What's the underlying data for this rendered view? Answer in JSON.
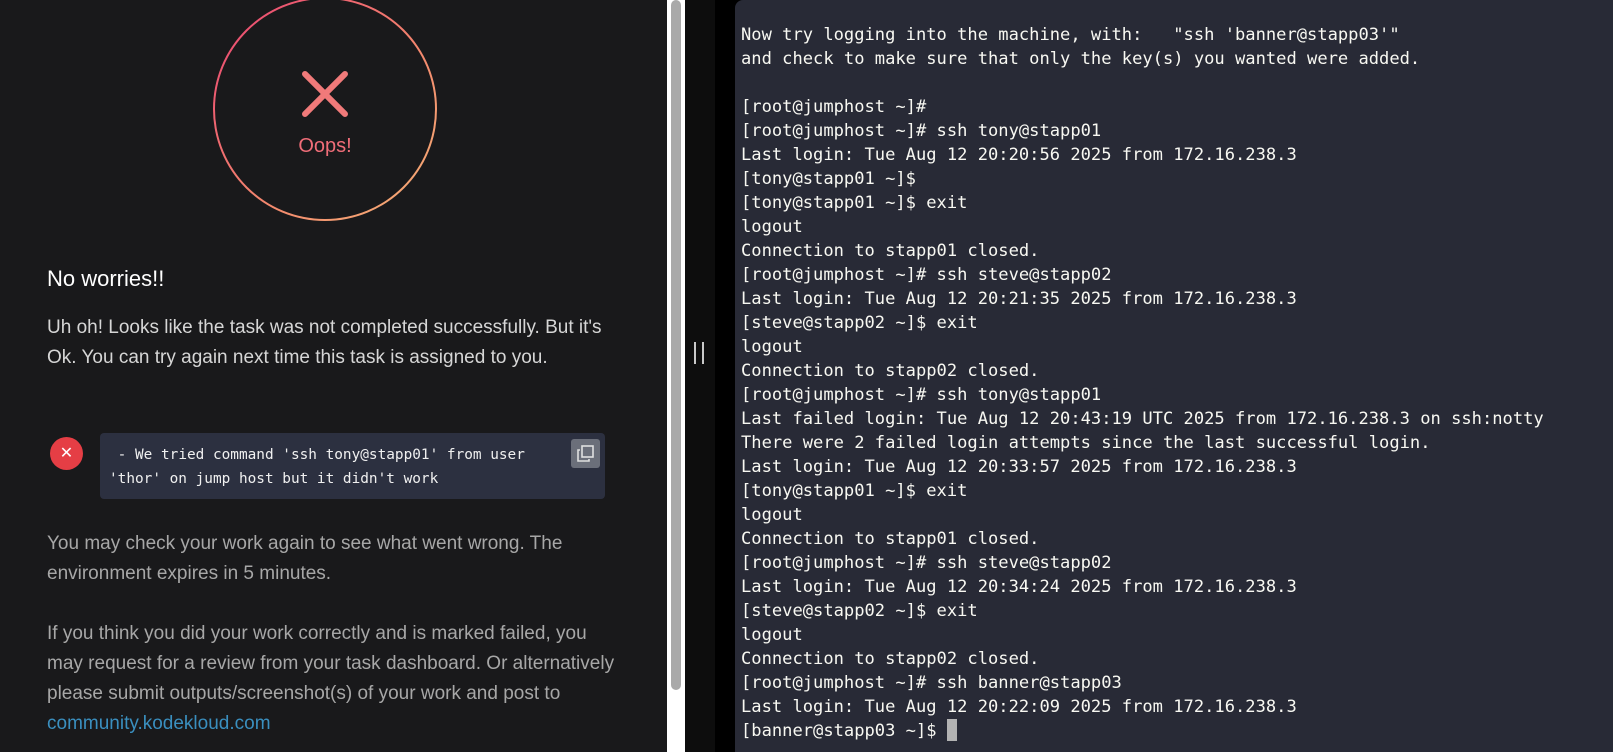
{
  "result_panel": {
    "status_text": "Oops!",
    "headline": "No worries!!",
    "body": "Uh oh! Looks like the task was not completed successfully. But it's Ok. You can try again next time this task is assigned to you.",
    "error_message": " - We tried command 'ssh tony@stapp01' from user 'thor' on jump host but it didn't work",
    "check_again_text": "You may check your work again to see what went wrong. The environment expires in 5 minutes.",
    "review_text": "If you think you did your work correctly and is marked failed, you may request for a review from your task dashboard. Or alternatively please submit outputs/screenshot(s) of your work and post to ",
    "community_link": "community.kodekloud.com"
  },
  "terminal": {
    "lines": [
      "Now try logging into the machine, with:   \"ssh 'banner@stapp03'\"",
      "and check to make sure that only the key(s) you wanted were added.",
      "",
      "[root@jumphost ~]#",
      "[root@jumphost ~]# ssh tony@stapp01",
      "Last login: Tue Aug 12 20:20:56 2025 from 172.16.238.3",
      "[tony@stapp01 ~]$",
      "[tony@stapp01 ~]$ exit",
      "logout",
      "Connection to stapp01 closed.",
      "[root@jumphost ~]# ssh steve@stapp02",
      "Last login: Tue Aug 12 20:21:35 2025 from 172.16.238.3",
      "[steve@stapp02 ~]$ exit",
      "logout",
      "Connection to stapp02 closed.",
      "[root@jumphost ~]# ssh tony@stapp01",
      "Last failed login: Tue Aug 12 20:43:19 UTC 2025 from 172.16.238.3 on ssh:notty",
      "There were 2 failed login attempts since the last successful login.",
      "Last login: Tue Aug 12 20:33:57 2025 from 172.16.238.3",
      "[tony@stapp01 ~]$ exit",
      "logout",
      "Connection to stapp01 closed.",
      "[root@jumphost ~]# ssh steve@stapp02",
      "Last login: Tue Aug 12 20:34:24 2025 from 172.16.238.3",
      "[steve@stapp02 ~]$ exit",
      "logout",
      "Connection to stapp02 closed.",
      "[root@jumphost ~]# ssh banner@stapp03",
      "Last login: Tue Aug 12 20:22:09 2025 from 172.16.238.3"
    ],
    "prompt": "[banner@stapp03 ~]$ "
  },
  "colors": {
    "panel_bg": "#19191b",
    "terminal_bg": "#282a36",
    "error_red": "#e53e45",
    "link_blue": "#3a8fbf",
    "status_pink": "#ef6d78"
  },
  "icons": {
    "status": "x-mark-icon",
    "error": "error-x-icon",
    "copy": "copy-icon",
    "divider": "drag-handle-icon"
  }
}
